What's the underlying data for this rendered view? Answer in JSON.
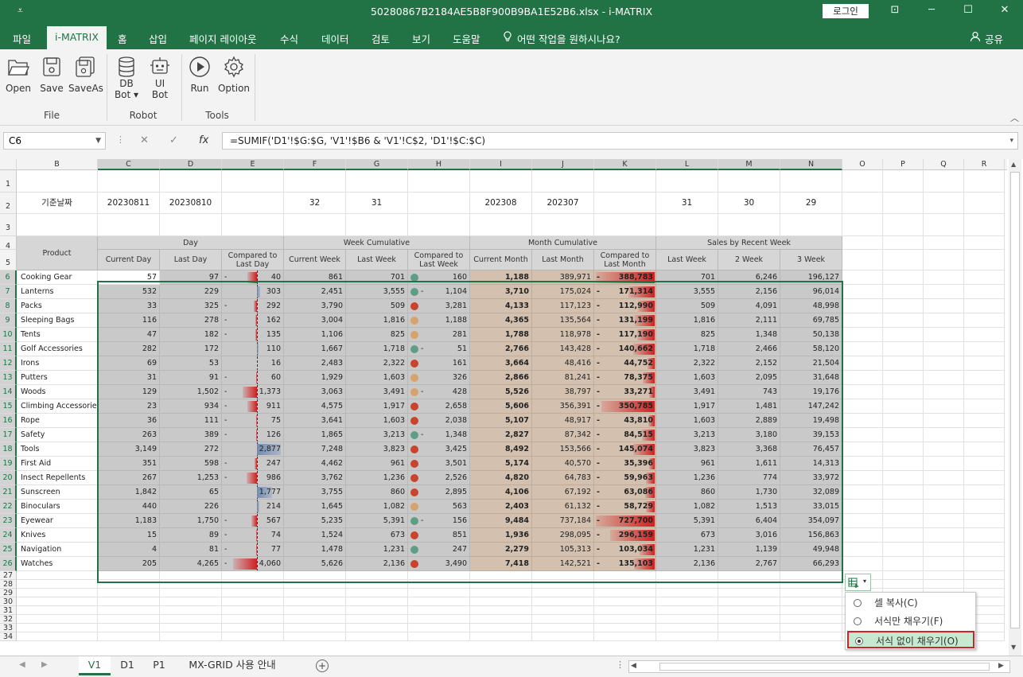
{
  "window": {
    "title": "50280867B2184AE5B8F900B9BA1E52B6.xlsx  -  i-MATRIX",
    "login": "로그인",
    "qa": "⩡",
    "min": "─",
    "restore": "☐",
    "close": "✕",
    "ribbon_opt": "⊡"
  },
  "menu": {
    "file": "파일",
    "imatrix": "i-MATRIX",
    "home": "홈",
    "insert": "삽입",
    "layout": "페이지 레이아웃",
    "formula": "수식",
    "data": "데이터",
    "review": "검토",
    "view": "보기",
    "help": "도움말",
    "tell": "어떤 작업을 원하시나요?",
    "share": "공유"
  },
  "ribbon": {
    "open": "Open",
    "save": "Save",
    "saveas": "SaveAs",
    "dbbot": "DB",
    "dbbot2": "Bot",
    "uibot": "UI",
    "uibot2": "Bot",
    "run": "Run",
    "option": "Option",
    "g_file": "File",
    "g_robot": "Robot",
    "g_tools": "Tools"
  },
  "formula_bar": {
    "namebox": "C6",
    "fx": "fx",
    "formula": "=SUMIF('D1'!$G:$G, 'V1'!$B6 & 'V1'!C$2, 'D1'!$C:$C)"
  },
  "columns": [
    "B",
    "C",
    "D",
    "E",
    "F",
    "G",
    "H",
    "I",
    "J",
    "K",
    "L",
    "M",
    "N",
    "O",
    "P",
    "Q",
    "R"
  ],
  "rows": [
    "1",
    "2",
    "3",
    "4",
    "5",
    "6",
    "7",
    "8",
    "9",
    "10",
    "11",
    "12",
    "13",
    "14",
    "15",
    "16",
    "17",
    "18",
    "19",
    "20",
    "21",
    "22",
    "23",
    "24",
    "25",
    "26",
    "27",
    "28",
    "29",
    "30",
    "31",
    "32",
    "33",
    "34"
  ],
  "row2": {
    "label": "기준날짜",
    "c": "20230811",
    "d": "20230810",
    "f": "32",
    "g": "31",
    "i": "202308",
    "j": "202307",
    "l": "31",
    "m": "30",
    "n": "29"
  },
  "headers": {
    "product": "Product",
    "day": "Day",
    "week_cum": "Week Cumulative",
    "month_cum": "Month Cumulative",
    "sales_recent": "Sales by Recent Week",
    "cur_day": "Current Day",
    "last_day": "Last Day",
    "cmp_day": "Compared to Last Day",
    "cur_week": "Current Week",
    "last_week": "Last Week",
    "cmp_week": "Compared to Last Week",
    "cur_month": "Current Month",
    "last_month": "Last Month",
    "cmp_month": "Compared to Last Month",
    "lw": "Last Week",
    "w2": "2 Week",
    "w3": "3 Week"
  },
  "data_rows": [
    {
      "p": "Cooking Gear",
      "cd": "57",
      "ld": "97",
      "e": "40",
      "es": "-",
      "ev": -0.41,
      "cw": "861",
      "lw": "701",
      "h": "160",
      "hs": "",
      "hd": "g",
      "cm": "1,188",
      "lm": "389,971",
      "k": "388,783",
      "ks": "-",
      "kv": -1.0,
      "r1": "701",
      "r2": "6,246",
      "r3": "196,127"
    },
    {
      "p": "Lanterns",
      "cd": "532",
      "ld": "229",
      "e": "303",
      "es": "",
      "ev": 0.13,
      "cw": "2,451",
      "lw": "3,555",
      "h": "1,104",
      "hs": "-",
      "hd": "g",
      "cm": "3,710",
      "lm": "175,024",
      "k": "171,314",
      "ks": "-",
      "kv": -0.44,
      "r1": "3,555",
      "r2": "2,156",
      "r3": "96,014"
    },
    {
      "p": "Packs",
      "cd": "33",
      "ld": "325",
      "e": "292",
      "es": "-",
      "ev": -0.13,
      "cw": "3,790",
      "lw": "509",
      "h": "3,281",
      "hs": "",
      "hd": "r",
      "cm": "4,133",
      "lm": "117,123",
      "k": "112,990",
      "ks": "-",
      "kv": -0.29,
      "r1": "509",
      "r2": "4,091",
      "r3": "48,998"
    },
    {
      "p": "Sleeping Bags",
      "cd": "116",
      "ld": "278",
      "e": "162",
      "es": "-",
      "ev": -0.07,
      "cw": "3,004",
      "lw": "1,816",
      "h": "1,188",
      "hs": "",
      "hd": "o",
      "cm": "4,365",
      "lm": "135,564",
      "k": "131,199",
      "ks": "-",
      "kv": -0.34,
      "r1": "1,816",
      "r2": "2,111",
      "r3": "69,785"
    },
    {
      "p": "Tents",
      "cd": "47",
      "ld": "182",
      "e": "135",
      "es": "-",
      "ev": -0.06,
      "cw": "1,106",
      "lw": "825",
      "h": "281",
      "hs": "",
      "hd": "o",
      "cm": "1,788",
      "lm": "118,978",
      "k": "117,190",
      "ks": "-",
      "kv": -0.3,
      "r1": "825",
      "r2": "1,348",
      "r3": "50,138"
    },
    {
      "p": "Golf Accessories",
      "cd": "282",
      "ld": "172",
      "e": "110",
      "es": "",
      "ev": 0.05,
      "cw": "1,667",
      "lw": "1,718",
      "h": "51",
      "hs": "-",
      "hd": "g",
      "cm": "2,766",
      "lm": "143,428",
      "k": "140,662",
      "ks": "-",
      "kv": -0.36,
      "r1": "1,718",
      "r2": "2,466",
      "r3": "58,120"
    },
    {
      "p": "Irons",
      "cd": "69",
      "ld": "53",
      "e": "16",
      "es": "",
      "ev": 0.01,
      "cw": "2,483",
      "lw": "2,322",
      "h": "161",
      "hs": "",
      "hd": "r",
      "cm": "3,664",
      "lm": "48,416",
      "k": "44,752",
      "ks": "-",
      "kv": -0.12,
      "r1": "2,322",
      "r2": "2,152",
      "r3": "21,504"
    },
    {
      "p": "Putters",
      "cd": "31",
      "ld": "91",
      "e": "60",
      "es": "-",
      "ev": -0.03,
      "cw": "1,929",
      "lw": "1,603",
      "h": "326",
      "hs": "",
      "hd": "o",
      "cm": "2,866",
      "lm": "81,241",
      "k": "78,375",
      "ks": "-",
      "kv": -0.2,
      "r1": "1,603",
      "r2": "2,095",
      "r3": "31,648"
    },
    {
      "p": "Woods",
      "cd": "129",
      "ld": "1,502",
      "e": "1,373",
      "es": "-",
      "ev": -0.6,
      "cw": "3,063",
      "lw": "3,491",
      "h": "428",
      "hs": "-",
      "hd": "o",
      "cm": "5,526",
      "lm": "38,797",
      "k": "33,271",
      "ks": "-",
      "kv": -0.09,
      "r1": "3,491",
      "r2": "743",
      "r3": "19,176"
    },
    {
      "p": "Climbing Accessories",
      "cd": "23",
      "ld": "934",
      "e": "911",
      "es": "-",
      "ev": -0.4,
      "cw": "4,575",
      "lw": "1,917",
      "h": "2,658",
      "hs": "",
      "hd": "r",
      "cm": "5,606",
      "lm": "356,391",
      "k": "350,785",
      "ks": "-",
      "kv": -0.9,
      "r1": "1,917",
      "r2": "1,481",
      "r3": "147,242"
    },
    {
      "p": "Rope",
      "cd": "36",
      "ld": "111",
      "e": "75",
      "es": "-",
      "ev": -0.03,
      "cw": "3,641",
      "lw": "1,603",
      "h": "2,038",
      "hs": "",
      "hd": "r",
      "cm": "5,107",
      "lm": "48,917",
      "k": "43,810",
      "ks": "-",
      "kv": -0.11,
      "r1": "1,603",
      "r2": "2,889",
      "r3": "19,498"
    },
    {
      "p": "Safety",
      "cd": "263",
      "ld": "389",
      "e": "126",
      "es": "-",
      "ev": -0.05,
      "cw": "1,865",
      "lw": "3,213",
      "h": "1,348",
      "hs": "-",
      "hd": "g",
      "cm": "2,827",
      "lm": "87,342",
      "k": "84,515",
      "ks": "-",
      "kv": -0.22,
      "r1": "3,213",
      "r2": "3,180",
      "r3": "39,153"
    },
    {
      "p": "Tools",
      "cd": "3,149",
      "ld": "272",
      "e": "2,877",
      "es": "",
      "ev": 1.0,
      "cw": "7,248",
      "lw": "3,823",
      "h": "3,425",
      "hs": "",
      "hd": "r",
      "cm": "8,492",
      "lm": "153,566",
      "k": "145,074",
      "ks": "-",
      "kv": -0.37,
      "r1": "3,823",
      "r2": "3,368",
      "r3": "76,457"
    },
    {
      "p": "First Aid",
      "cd": "351",
      "ld": "598",
      "e": "247",
      "es": "-",
      "ev": -0.11,
      "cw": "4,462",
      "lw": "961",
      "h": "3,501",
      "hs": "",
      "hd": "r",
      "cm": "5,174",
      "lm": "40,570",
      "k": "35,396",
      "ks": "-",
      "kv": -0.09,
      "r1": "961",
      "r2": "1,611",
      "r3": "14,313"
    },
    {
      "p": "Insect Repellents",
      "cd": "267",
      "ld": "1,253",
      "e": "986",
      "es": "-",
      "ev": -0.43,
      "cw": "3,762",
      "lw": "1,236",
      "h": "2,526",
      "hs": "",
      "hd": "r",
      "cm": "4,820",
      "lm": "64,783",
      "k": "59,963",
      "ks": "-",
      "kv": -0.15,
      "r1": "1,236",
      "r2": "774",
      "r3": "33,972"
    },
    {
      "p": "Sunscreen",
      "cd": "1,842",
      "ld": "65",
      "e": "1,777",
      "es": "",
      "ev": 0.62,
      "cw": "3,755",
      "lw": "860",
      "h": "2,895",
      "hs": "",
      "hd": "r",
      "cm": "4,106",
      "lm": "67,192",
      "k": "63,086",
      "ks": "-",
      "kv": -0.16,
      "r1": "860",
      "r2": "1,730",
      "r3": "32,089"
    },
    {
      "p": "Binoculars",
      "cd": "440",
      "ld": "226",
      "e": "214",
      "es": "",
      "ev": 0.09,
      "cw": "1,645",
      "lw": "1,082",
      "h": "563",
      "hs": "",
      "hd": "o",
      "cm": "2,403",
      "lm": "61,132",
      "k": "58,729",
      "ks": "-",
      "kv": -0.15,
      "r1": "1,082",
      "r2": "1,513",
      "r3": "33,015"
    },
    {
      "p": "Eyewear",
      "cd": "1,183",
      "ld": "1,750",
      "e": "567",
      "es": "-",
      "ev": -0.25,
      "cw": "5,235",
      "lw": "5,391",
      "h": "156",
      "hs": "-",
      "hd": "g",
      "cm": "9,484",
      "lm": "737,184",
      "k": "727,700",
      "ks": "-",
      "kv": -1.0,
      "r1": "5,391",
      "r2": "6,404",
      "r3": "354,097"
    },
    {
      "p": "Knives",
      "cd": "15",
      "ld": "89",
      "e": "74",
      "es": "-",
      "ev": -0.03,
      "cw": "1,524",
      "lw": "673",
      "h": "851",
      "hs": "",
      "hd": "r",
      "cm": "1,936",
      "lm": "298,095",
      "k": "296,159",
      "ks": "-",
      "kv": -0.76,
      "r1": "673",
      "r2": "3,016",
      "r3": "156,863"
    },
    {
      "p": "Navigation",
      "cd": "4",
      "ld": "81",
      "e": "77",
      "es": "-",
      "ev": -0.03,
      "cw": "1,478",
      "lw": "1,231",
      "h": "247",
      "hs": "",
      "hd": "g",
      "cm": "2,279",
      "lm": "105,313",
      "k": "103,034",
      "ks": "-",
      "kv": -0.26,
      "r1": "1,231",
      "r2": "1,139",
      "r3": "49,948"
    },
    {
      "p": "Watches",
      "cd": "205",
      "ld": "4,265",
      "e": "4,060",
      "es": "-",
      "ev": -1.0,
      "cw": "5,626",
      "lw": "2,136",
      "h": "3,490",
      "hs": "",
      "hd": "r",
      "cm": "7,418",
      "lm": "142,521",
      "k": "135,103",
      "ks": "-",
      "kv": -0.35,
      "r1": "2,136",
      "r2": "2,767",
      "r3": "66,293"
    }
  ],
  "paste_menu": {
    "copy": "셀 복사(C)",
    "format_only": "서식만 채우기(F)",
    "no_format": "서식 없이 채우기(O)"
  },
  "tabs": {
    "v1": "V1",
    "d1": "D1",
    "p1": "P1",
    "guide": "MX-GRID 사용 안내",
    "add": "+"
  },
  "colors": {
    "accent": "#217346",
    "pos": "#6f8cb8",
    "neg": "#d02020"
  }
}
